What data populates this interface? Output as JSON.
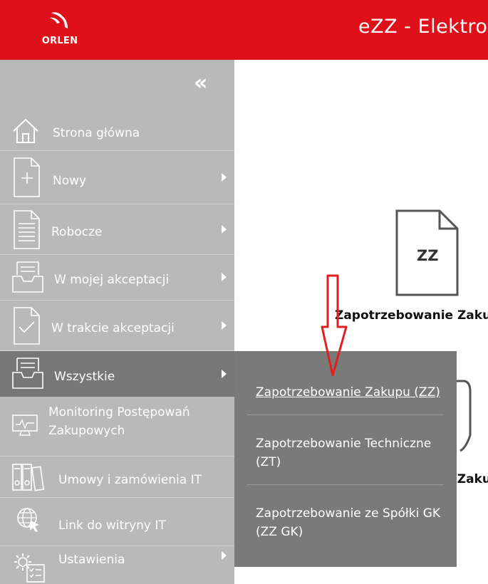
{
  "header": {
    "logo_text": "ORLEN",
    "app_title": "eZZ - Elektron"
  },
  "sidebar": {
    "collapse_glyph": "«",
    "items": [
      {
        "label": "Strona główna",
        "icon": "home-icon"
      },
      {
        "label": "Nowy",
        "icon": "new-document-icon"
      },
      {
        "label": "Robocze",
        "icon": "draft-document-icon"
      },
      {
        "label": "W mojej akceptacji",
        "icon": "inbox-tray-icon"
      },
      {
        "label": "W trakcie akceptacji",
        "icon": "check-document-icon"
      },
      {
        "label": "Wszystkie",
        "icon": "inbox-tray-icon"
      },
      {
        "label_line1": "Monitoring Postępowań",
        "label_line2": "Zakupowych",
        "icon": "monitor-icon"
      },
      {
        "label": "Umowy i zamówienia IT",
        "icon": "binders-icon"
      },
      {
        "label": "Link do witryny IT",
        "icon": "globe-cursor-icon"
      },
      {
        "label": "Ustawienia",
        "icon": "settings-gear-icon"
      }
    ]
  },
  "main": {
    "tile1": {
      "doc_label": "ZZ",
      "title": "Zapotrzebowanie Zakupu"
    },
    "tile2": {
      "title_fragment": "i Zakup"
    }
  },
  "submenu": {
    "items": [
      {
        "line1": "Zapotrzebowanie Zakupu (ZZ)"
      },
      {
        "line1": "Zapotrzebowanie Techniczne",
        "line2": "(ZT)"
      },
      {
        "line1": "Zapotrzebowanie ze Spółki GK",
        "line2": "(ZZ GK)"
      }
    ]
  },
  "colors": {
    "brand_red": "#e0101a",
    "sidebar_bg": "#b9b9b9",
    "active_bg": "#777777",
    "submenu_bg": "#7a7a7a",
    "annotation_arrow": "#e02020"
  }
}
